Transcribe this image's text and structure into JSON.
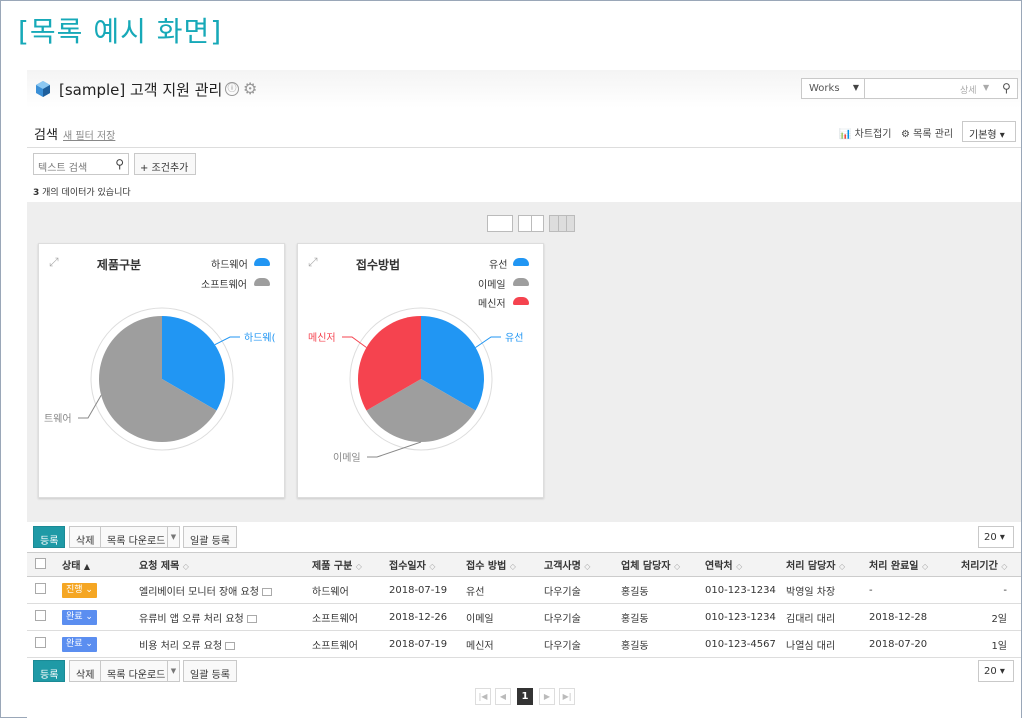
{
  "caption": "[목록 예시 화면]",
  "header": {
    "title": "[sample] 고객 지원 관리",
    "info_icon": "ⓘ",
    "works_select": "Works",
    "search_detail": "상세"
  },
  "search": {
    "label": "검색",
    "save_filter": "새 필터 저장",
    "chart_toggle": "차트접기",
    "list_manage": "목록 관리",
    "view_mode": "기본형 ▾",
    "text_placeholder": "텍스트 검색",
    "add_condition": "+ 조건추가",
    "count_number": "3",
    "count_text": " 개의 데이터가 있습니다"
  },
  "colors": {
    "blue": "#2196f3",
    "gray": "#9e9e9e",
    "red": "#f5434f",
    "accent": "#1f9aa6"
  },
  "charts": [
    {
      "title": "제품구분",
      "legend": [
        {
          "label": "하드웨어",
          "color": "#2196f3"
        },
        {
          "label": "소프트웨어",
          "color": "#9e9e9e"
        }
      ],
      "slice_labels": [
        "하드웨(",
        "트웨어"
      ]
    },
    {
      "title": "접수방법",
      "legend": [
        {
          "label": "유선",
          "color": "#2196f3"
        },
        {
          "label": "이메일",
          "color": "#9e9e9e"
        },
        {
          "label": "메신저",
          "color": "#f5434f"
        }
      ],
      "slice_labels": [
        "유선",
        "이메일",
        "메신저"
      ]
    }
  ],
  "chart_data": [
    {
      "type": "pie",
      "title": "제품구분",
      "categories": [
        "하드웨어",
        "소프트웨어"
      ],
      "values": [
        1,
        2
      ]
    },
    {
      "type": "pie",
      "title": "접수방법",
      "categories": [
        "유선",
        "이메일",
        "메신저"
      ],
      "values": [
        1,
        1,
        1
      ]
    }
  ],
  "toolbar": {
    "register": "등록",
    "delete": "삭제",
    "download": "목록 다운로드",
    "bulk_register": "일괄 등록",
    "page_size": "20 ▾"
  },
  "table": {
    "headers": [
      "상태",
      "요청 제목",
      "제품 구분",
      "접수일자",
      "접수 방법",
      "고객사명",
      "업체 담당자",
      "연락처",
      "처리 담당자",
      "처리 완료일",
      "처리기간"
    ],
    "sort_asc": "▲",
    "sort_both": "◇",
    "rows": [
      {
        "status": "진행 ⌄",
        "status_color": "orange",
        "title": "엘리베이터 모니터 장애 요청",
        "product": "하드웨어",
        "date": "2018-07-19",
        "method": "유선",
        "customer": "다우기술",
        "vendor_mgr": "홍길동",
        "phone": "010-123-1234",
        "handler": "박영일 차장",
        "done_date": "-",
        "period": "-"
      },
      {
        "status": "완료 ⌄",
        "status_color": "blue",
        "title": "유류비 앱 오류 처리 요청",
        "product": "소프트웨어",
        "date": "2018-12-26",
        "method": "이메일",
        "customer": "다우기술",
        "vendor_mgr": "홍길동",
        "phone": "010-123-1234",
        "handler": "김대리 대리",
        "done_date": "2018-12-28",
        "period": "2일"
      },
      {
        "status": "완료 ⌄",
        "status_color": "blue",
        "title": "비용 처리 오류 요청",
        "product": "소프트웨어",
        "date": "2018-07-19",
        "method": "메신저",
        "customer": "다우기술",
        "vendor_mgr": "홍길동",
        "phone": "010-123-4567",
        "handler": "나열심 대리",
        "done_date": "2018-07-20",
        "period": "1일"
      }
    ]
  },
  "pagination": {
    "first": "|◀",
    "prev": "◀",
    "current": "1",
    "next": "▶",
    "last": "▶|"
  }
}
